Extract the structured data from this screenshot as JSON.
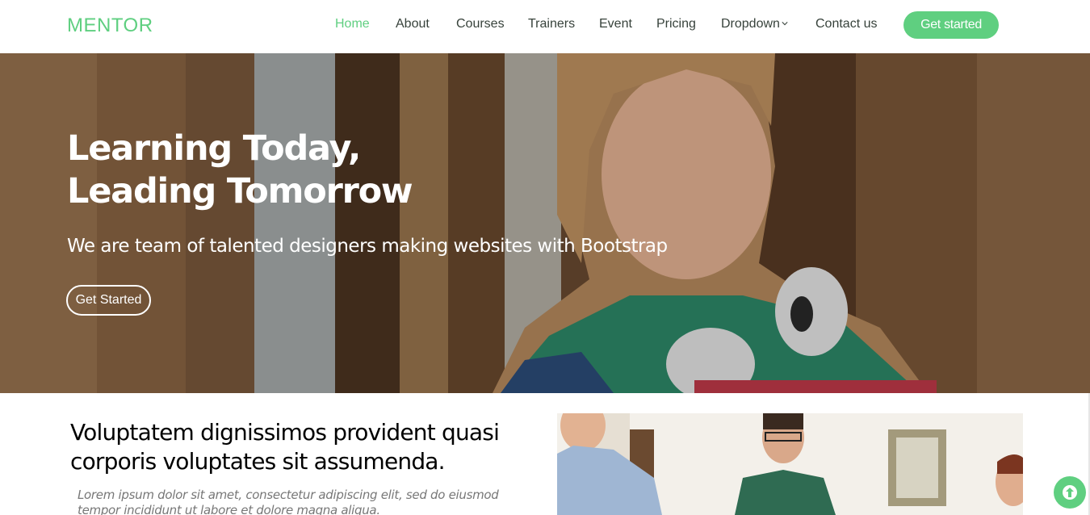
{
  "brand": {
    "logo": "MENTOR",
    "accent": "#5fcf80"
  },
  "nav": {
    "items": [
      {
        "label": "Home",
        "active": true
      },
      {
        "label": "About"
      },
      {
        "label": "Courses"
      },
      {
        "label": "Trainers"
      },
      {
        "label": "Event"
      },
      {
        "label": "Pricing"
      },
      {
        "label": "Dropdown",
        "icon": "chevron-down-icon"
      },
      {
        "label": "Contact us"
      }
    ],
    "cta": "Get started"
  },
  "hero": {
    "title_line1": "Learning Today,",
    "title_line2": "Leading Tomorrow",
    "subtitle": "We are team of talented designers making websites with Bootstrap",
    "button": "Get Started"
  },
  "about": {
    "heading": "Voluptatem dignissimos provident quasi corporis voluptates sit assumenda.",
    "text": "Lorem ipsum dolor sit amet, consectetur adipiscing elit, sed do eiusmod tempor incididunt ut labore et dolore magna aliqua."
  },
  "back_to_top": {
    "icon": "arrow-up-icon"
  }
}
